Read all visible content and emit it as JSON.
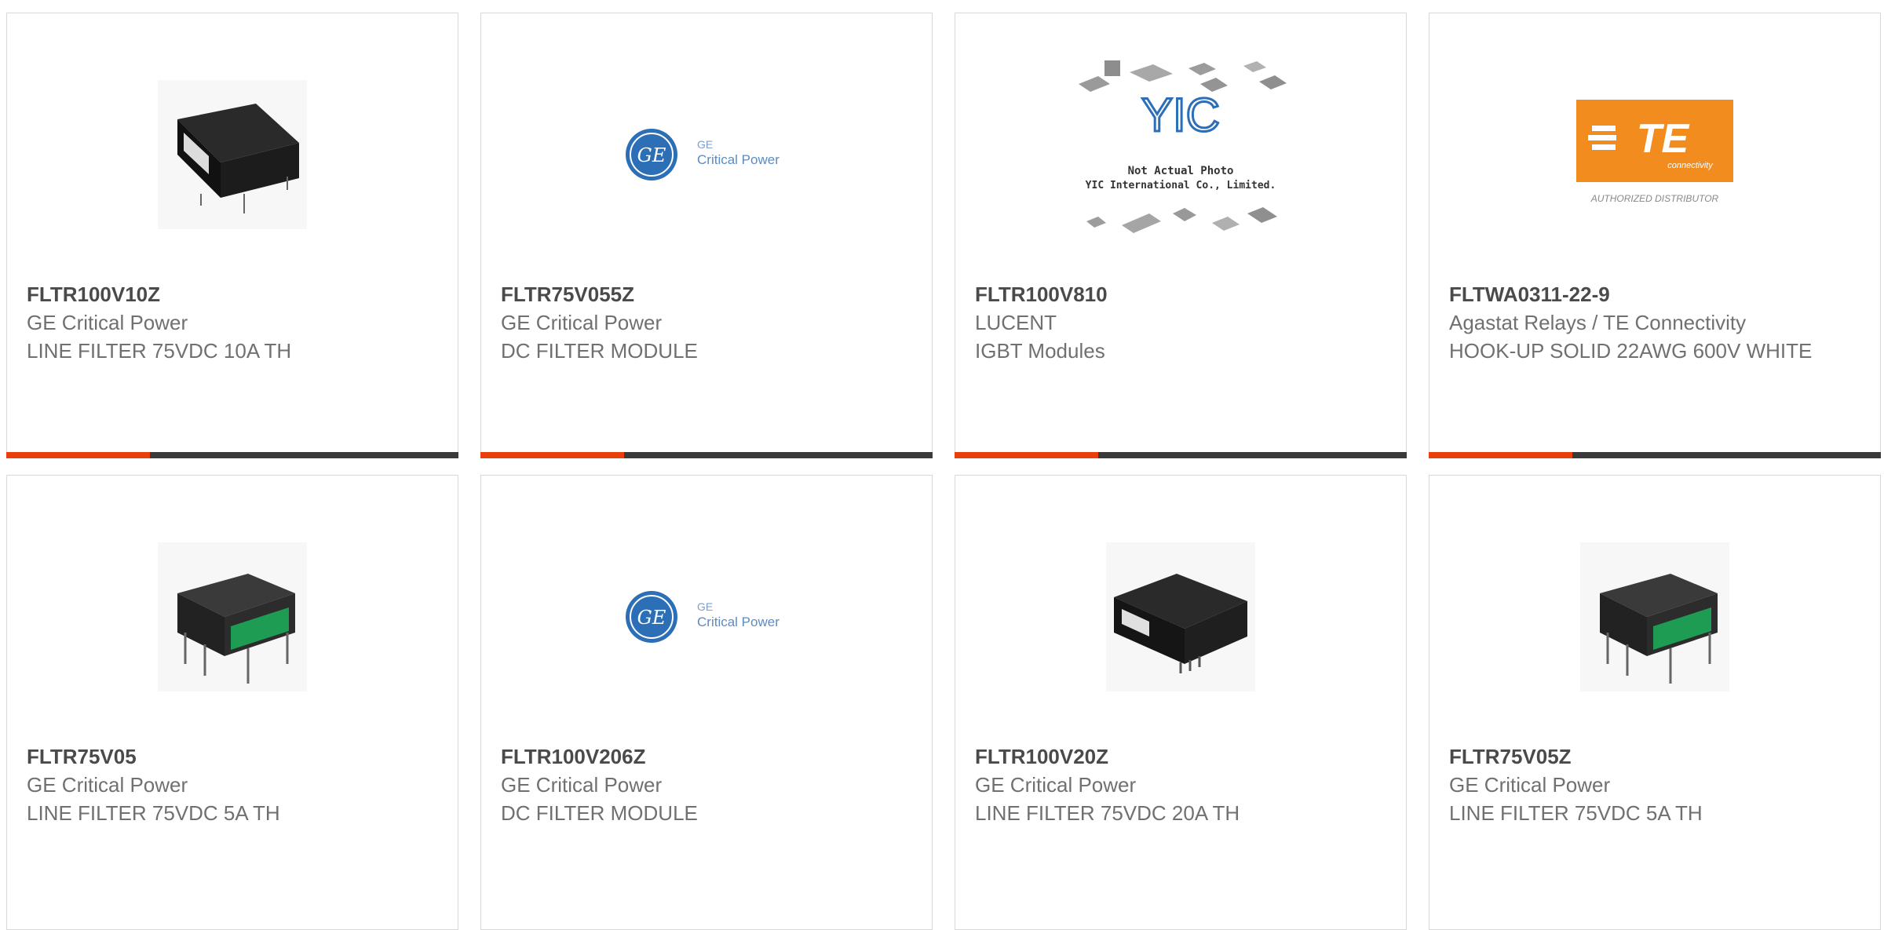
{
  "products": [
    {
      "part": "FLTR100V10Z",
      "manufacturer": "GE Critical Power",
      "description": "LINE FILTER 75VDC 10A TH",
      "image": "black-filter-module-image"
    },
    {
      "part": "FLTR75V055Z",
      "manufacturer": "GE Critical Power",
      "description": "DC FILTER MODULE",
      "image": "ge-logo-image",
      "logo": {
        "line1": "GE",
        "line2": "Critical Power",
        "mark": "GE"
      }
    },
    {
      "part": "FLTR100V810",
      "manufacturer": "LUCENT",
      "description": "IGBT Modules",
      "image": "yic-placeholder-image",
      "logo": {
        "mark": "YIC",
        "line1": "Not Actual Photo",
        "line2": "YIC International Co., Limited."
      }
    },
    {
      "part": "FLTWA0311-22-9",
      "manufacturer": "Agastat Relays / TE Connectivity",
      "description": "HOOK-UP SOLID 22AWG 600V WHITE",
      "image": "te-logo-image",
      "logo": {
        "mark": "TE",
        "sub": "connectivity",
        "line1": "AUTHORIZED DISTRIBUTOR"
      }
    },
    {
      "part": "FLTR75V05",
      "manufacturer": "GE Critical Power",
      "description": "LINE FILTER 75VDC 5A TH",
      "image": "green-filter-module-image"
    },
    {
      "part": "FLTR100V206Z",
      "manufacturer": "GE Critical Power",
      "description": "DC FILTER MODULE",
      "image": "ge-logo-image",
      "logo": {
        "line1": "GE",
        "line2": "Critical Power",
        "mark": "GE"
      }
    },
    {
      "part": "FLTR100V20Z",
      "manufacturer": "GE Critical Power",
      "description": "LINE FILTER 75VDC 20A TH",
      "image": "black-square-module-image"
    },
    {
      "part": "FLTR75V05Z",
      "manufacturer": "GE Critical Power",
      "description": "LINE FILTER 75VDC 5A TH",
      "image": "green-filter-module-image"
    }
  ],
  "colors": {
    "accent": "#e8400c",
    "bar": "#3a3a3a",
    "ge_blue": "#2c6fb7",
    "te_orange": "#f28c1e"
  }
}
